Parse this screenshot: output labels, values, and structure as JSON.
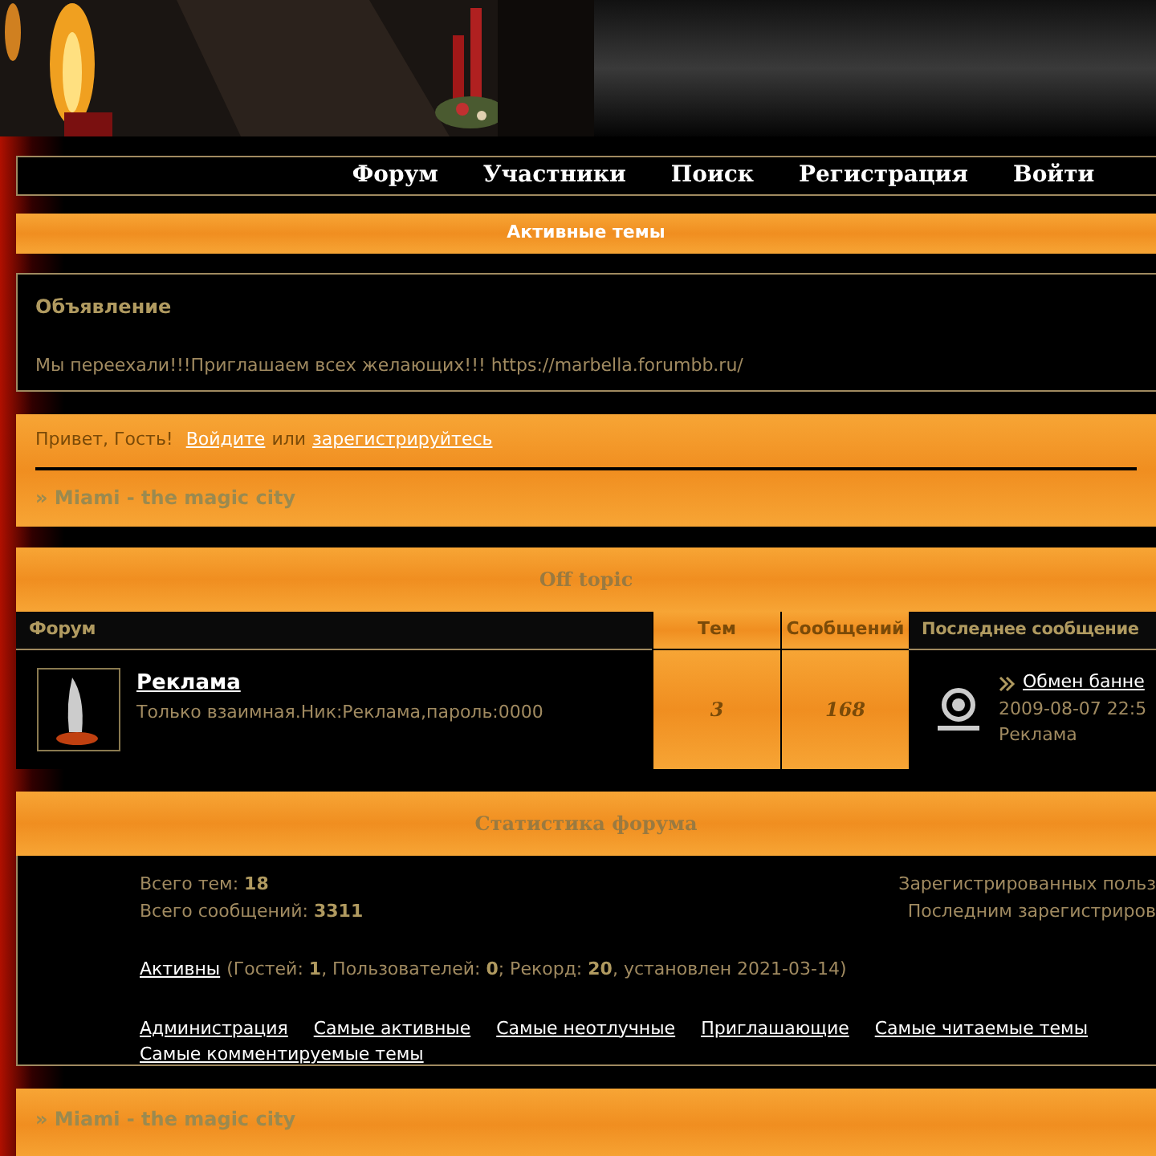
{
  "nav": [
    "Форум",
    "Участники",
    "Поиск",
    "Регистрация",
    "Войти"
  ],
  "active_topics": "Активные темы",
  "announcement": {
    "title": "Объявление",
    "text": "Мы переехали!!!Приглашаем всех желающих!!! https://marbella.forumbb.ru/"
  },
  "greeting": {
    "text": "Привет, Гость!",
    "login": "Войдите",
    "or": "или",
    "register": "зарегистрируйтесь"
  },
  "crumb_top": "» Miami - the magic city",
  "category": {
    "title": "Off topic",
    "columns": [
      "Форум",
      "Тем",
      "Сообщений",
      "Последнее сообщение"
    ],
    "forums": [
      {
        "name": "Реклама",
        "description": "Только взаимная.Ник:Реклама,пароль:0000",
        "topics": "3",
        "posts": "168",
        "last_topic": "Обмен банне",
        "last_date": "2009-08-07 22:5",
        "last_author": "Реклама"
      }
    ]
  },
  "stats": {
    "title": "Статистика форума",
    "topics_label": "Всего тем:",
    "topics": "18",
    "posts_label": "Всего сообщений:",
    "posts": "3311",
    "registered": "Зарегистрированных польз",
    "last_registered": "Последним зарегистриров",
    "online_link": "Активны",
    "online_text": "(Гостей: **1**, Пользователей: **0**; Рекорд: **20**, установлен 2021-03-14)",
    "links": [
      "Администрация",
      "Самые активные",
      "Самые неотлучные",
      "Приглашающие",
      "Самые читаемые темы",
      "Самые комментируемые темы"
    ]
  },
  "crumb_bottom": "» Miami - the magic city"
}
